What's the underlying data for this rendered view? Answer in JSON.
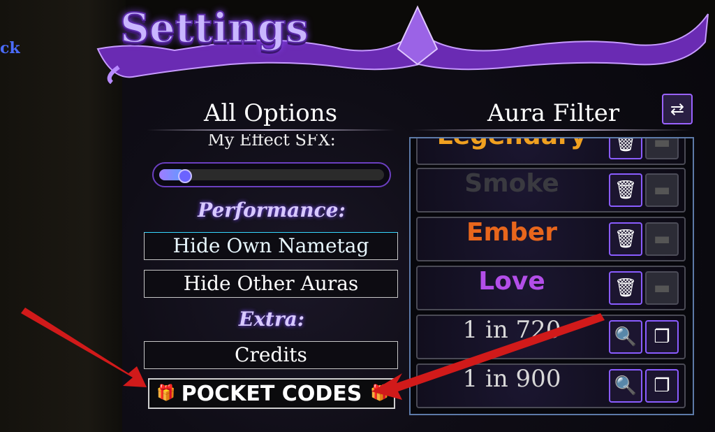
{
  "page": {
    "back_link": "ck",
    "title": "Settings"
  },
  "left_column": {
    "header": "All Options",
    "sfx_label": "My Effect SFX:",
    "sfx_slider_value": 0.07,
    "sections": [
      {
        "label": "Performance:"
      },
      {
        "label": "Extra:"
      }
    ],
    "buttons": {
      "hide_own_nametag": "Hide Own Nametag",
      "hide_other_auras": "Hide Other Auras",
      "credits": "Credits",
      "pocket_codes": "POCKET CODES"
    }
  },
  "right_column": {
    "header": "Aura Filter",
    "refresh_icon": "swap-arrows-icon",
    "rows": [
      {
        "name": "Legendary",
        "color": "#f0a020",
        "actions": [
          "trash-icon",
          "camera-icon"
        ]
      },
      {
        "name": "Smoke",
        "color": "#3a3a40",
        "actions": [
          "trash-icon",
          "camera-icon"
        ]
      },
      {
        "name": "Ember",
        "color": "#e8661c",
        "actions": [
          "trash-icon",
          "camera-icon"
        ]
      },
      {
        "name": "Love",
        "color": "#b34ee8",
        "actions": [
          "trash-icon",
          "camera-icon"
        ]
      },
      {
        "name": "1 in 720",
        "color": "#d8d8d8",
        "actions": [
          "magnifier-icon",
          "copy-icon"
        ]
      },
      {
        "name": "1 in 900",
        "color": "#d8d8d8",
        "actions": [
          "magnifier-icon",
          "copy-icon"
        ]
      }
    ]
  },
  "colors": {
    "accent": "#9a62ff",
    "arrow": "#d11a1a"
  }
}
